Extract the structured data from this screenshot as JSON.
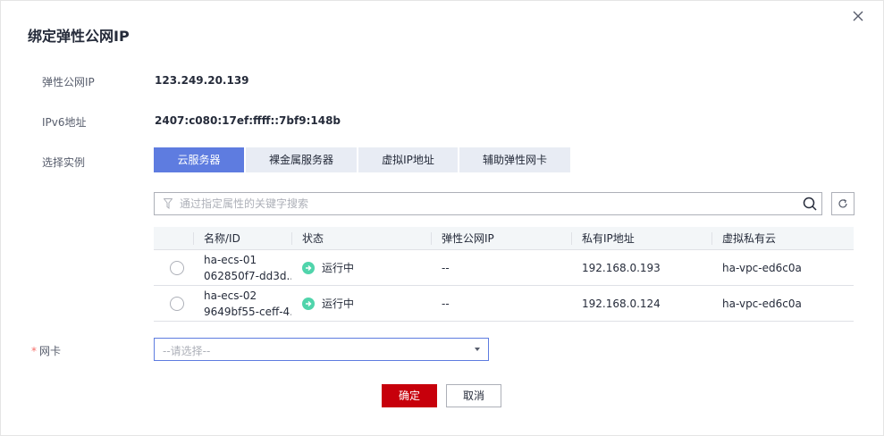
{
  "dialog": {
    "title": "绑定弹性公网IP",
    "close_icon": "close-icon"
  },
  "fields": {
    "eip_label": "弹性公网IP",
    "eip_value": "123.249.20.139",
    "ipv6_label": "IPv6地址",
    "ipv6_value": "2407:c080:17ef:ffff::7bf9:148b",
    "instance_label": "选择实例"
  },
  "tabs": [
    {
      "label": "云服务器",
      "active": true
    },
    {
      "label": "裸金属服务器",
      "active": false
    },
    {
      "label": "虚拟IP地址",
      "active": false
    },
    {
      "label": "辅助弹性网卡",
      "active": false
    }
  ],
  "search": {
    "placeholder": "通过指定属性的关键字搜索",
    "value": ""
  },
  "table": {
    "columns": [
      "名称/ID",
      "状态",
      "弹性公网IP",
      "私有IP地址",
      "虚拟私有云"
    ],
    "rows": [
      {
        "name": "ha-ecs-01",
        "id": "062850f7-dd3d...",
        "status": "运行中",
        "eip": "--",
        "private_ip": "192.168.0.193",
        "vpc": "ha-vpc-ed6c0a",
        "selected": false
      },
      {
        "name": "ha-ecs-02",
        "id": "9649bf55-ceff-4...",
        "status": "运行中",
        "eip": "--",
        "private_ip": "192.168.0.124",
        "vpc": "ha-vpc-ed6c0a",
        "selected": false
      }
    ]
  },
  "nic": {
    "required_mark": "*",
    "label": "网卡",
    "placeholder": "--请选择--"
  },
  "buttons": {
    "ok": "确定",
    "cancel": "取消"
  },
  "colors": {
    "primary_tab": "#5e7ce0",
    "ok_button": "#c7000b",
    "status_running": "#50d4ab"
  }
}
